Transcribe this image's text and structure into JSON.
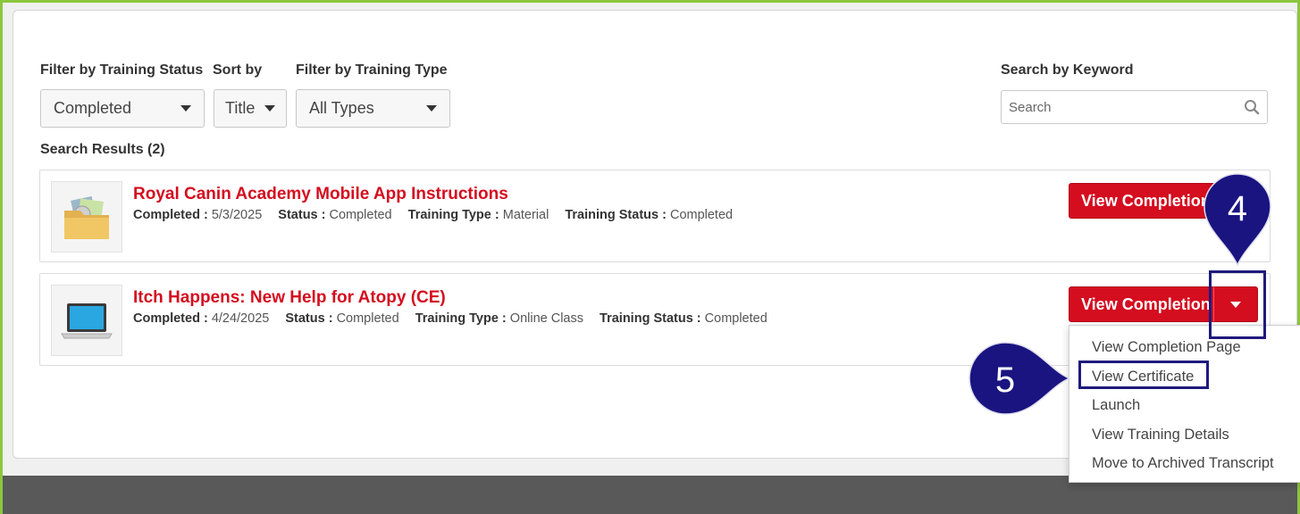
{
  "filters": {
    "status_label": "Filter by Training Status",
    "status_value": "Completed",
    "sort_label": "Sort by",
    "sort_value": "Title",
    "type_label": "Filter by Training Type",
    "type_value": "All Types",
    "keyword_label": "Search by Keyword",
    "keyword_placeholder": "Search"
  },
  "results_label": "Search Results (2)",
  "results": [
    {
      "title": "Royal Canin Academy Mobile App Instructions",
      "completed_label": "Completed :",
      "completed": "5/3/2025",
      "status_label": "Status :",
      "status": "Completed",
      "type_label": "Training Type :",
      "type": "Material",
      "tstatus_label": "Training Status :",
      "tstatus": "Completed",
      "button": "View Completion Page",
      "thumb_icon": "folder-icon"
    },
    {
      "title": "Itch Happens: New Help for Atopy (CE)",
      "completed_label": "Completed :",
      "completed": "4/24/2025",
      "status_label": "Status :",
      "status": "Completed",
      "type_label": "Training Type :",
      "type": "Online Class",
      "tstatus_label": "Training Status :",
      "tstatus": "Completed",
      "button": "View Completion Page",
      "thumb_icon": "laptop-icon"
    }
  ],
  "menu": {
    "items": [
      "View Completion Page",
      "View Certificate",
      "Launch",
      "View Training Details",
      "Move to Archived Transcript"
    ]
  },
  "annotations": {
    "step4": "4",
    "step5": "5",
    "color": "#1f1a7d"
  },
  "colors": {
    "accent": "#d40d1f",
    "frame": "#8cc63f",
    "footer": "#595959"
  }
}
